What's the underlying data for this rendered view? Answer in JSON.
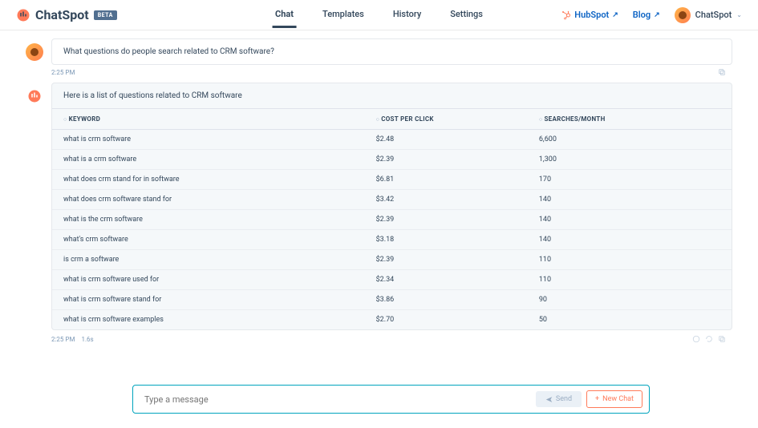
{
  "header": {
    "logo_text": "ChatSpot",
    "beta": "BETA",
    "tabs": [
      "Chat",
      "Templates",
      "History",
      "Settings"
    ],
    "hubspot": "HubSpot",
    "blog": "Blog",
    "user": "ChatSpot"
  },
  "user_msg": {
    "text": "What questions do people search related to CRM software?",
    "time": "2:25 PM"
  },
  "bot_msg": {
    "intro": "Here is a list of questions related to CRM software",
    "columns": {
      "k": "KEYWORD",
      "c": "COST PER CLICK",
      "s": "SEARCHES/MONTH"
    },
    "rows": [
      {
        "k": "what is crm software",
        "c": "$2.48",
        "s": "6,600"
      },
      {
        "k": "what is a crm software",
        "c": "$2.39",
        "s": "1,300"
      },
      {
        "k": "what does crm stand for in software",
        "c": "$6.81",
        "s": "170"
      },
      {
        "k": "what does crm software stand for",
        "c": "$3.42",
        "s": "140"
      },
      {
        "k": "what is the crm software",
        "c": "$2.39",
        "s": "140"
      },
      {
        "k": "what's crm software",
        "c": "$3.18",
        "s": "140"
      },
      {
        "k": "is crm a software",
        "c": "$2.39",
        "s": "110"
      },
      {
        "k": "what is crm software used for",
        "c": "$2.34",
        "s": "110"
      },
      {
        "k": "what is crm software stand for",
        "c": "$3.86",
        "s": "90"
      },
      {
        "k": "what is crm software examples",
        "c": "$2.70",
        "s": "50"
      }
    ],
    "time": "2:25 PM",
    "latency": "1.6s"
  },
  "input": {
    "placeholder": "Type a message",
    "send": "Send",
    "new_chat": "New Chat"
  }
}
